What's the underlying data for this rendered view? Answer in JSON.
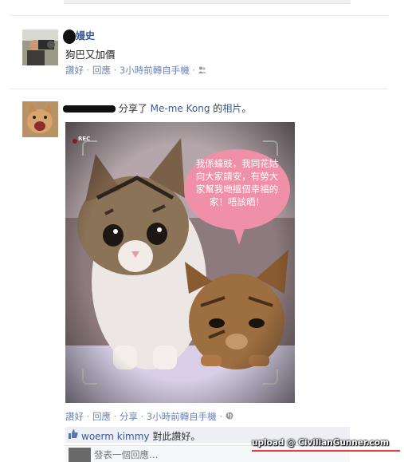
{
  "post1": {
    "author": "嫚史",
    "text": "狗巴又加價",
    "actions": {
      "like": "讚好",
      "comment": "回應",
      "time": "3小時前轉自手機"
    }
  },
  "post2": {
    "shared_text": "分享了",
    "page_name": "Me-me Kong",
    "possessive": "的",
    "photo_label": "相片",
    "rec_label": "REC",
    "bubble_text": "我係蠔豉，我同花姑向大家請安，有勞大家幫我哋搵個幸福的家！唔該晒！",
    "actions": {
      "like": "讚好",
      "comment": "回應",
      "share": "分享",
      "time": "3小時前轉自手機"
    },
    "likes": {
      "user": "woerm kimmy",
      "text": "對此讚好。"
    },
    "comment_prompt": "發表一個回應…"
  },
  "watermark": "upload @ CivilianGunner.com",
  "colors": {
    "link": "#3b5998",
    "meta": "#6d84b4",
    "bubble": "#f08fa8"
  }
}
